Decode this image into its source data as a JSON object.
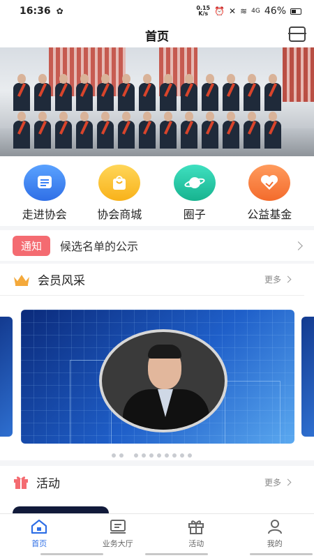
{
  "status_bar": {
    "time": "16:36",
    "net_speed": "0.15 K/s",
    "signal": "4G",
    "battery": "46%"
  },
  "header": {
    "title": "首页"
  },
  "quick_menu": [
    {
      "label": "走进协会",
      "icon": "document-icon",
      "color": "#3b82f6"
    },
    {
      "label": "协会商城",
      "icon": "shopping-bag-icon",
      "color": "#f8b21a"
    },
    {
      "label": "圈子",
      "icon": "planet-icon",
      "color": "#17b38f"
    },
    {
      "label": "公益基金",
      "icon": "heart-hand-icon",
      "color": "#f36b2c"
    }
  ],
  "notice": {
    "tag": "通知",
    "text": "候选名单的公示"
  },
  "member_section": {
    "title": "会员风采",
    "more": "更多"
  },
  "activity_section": {
    "title": "活动",
    "more": "更多"
  },
  "tabbar": [
    {
      "label": "首页",
      "icon": "home-icon",
      "active": true
    },
    {
      "label": "业务大厅",
      "icon": "service-hall-icon",
      "active": false
    },
    {
      "label": "活动",
      "icon": "gift-icon",
      "active": false
    },
    {
      "label": "我的",
      "icon": "user-icon",
      "active": false
    }
  ],
  "colors": {
    "accent": "#2f6fe6",
    "notice_tag": "#f46b71"
  }
}
